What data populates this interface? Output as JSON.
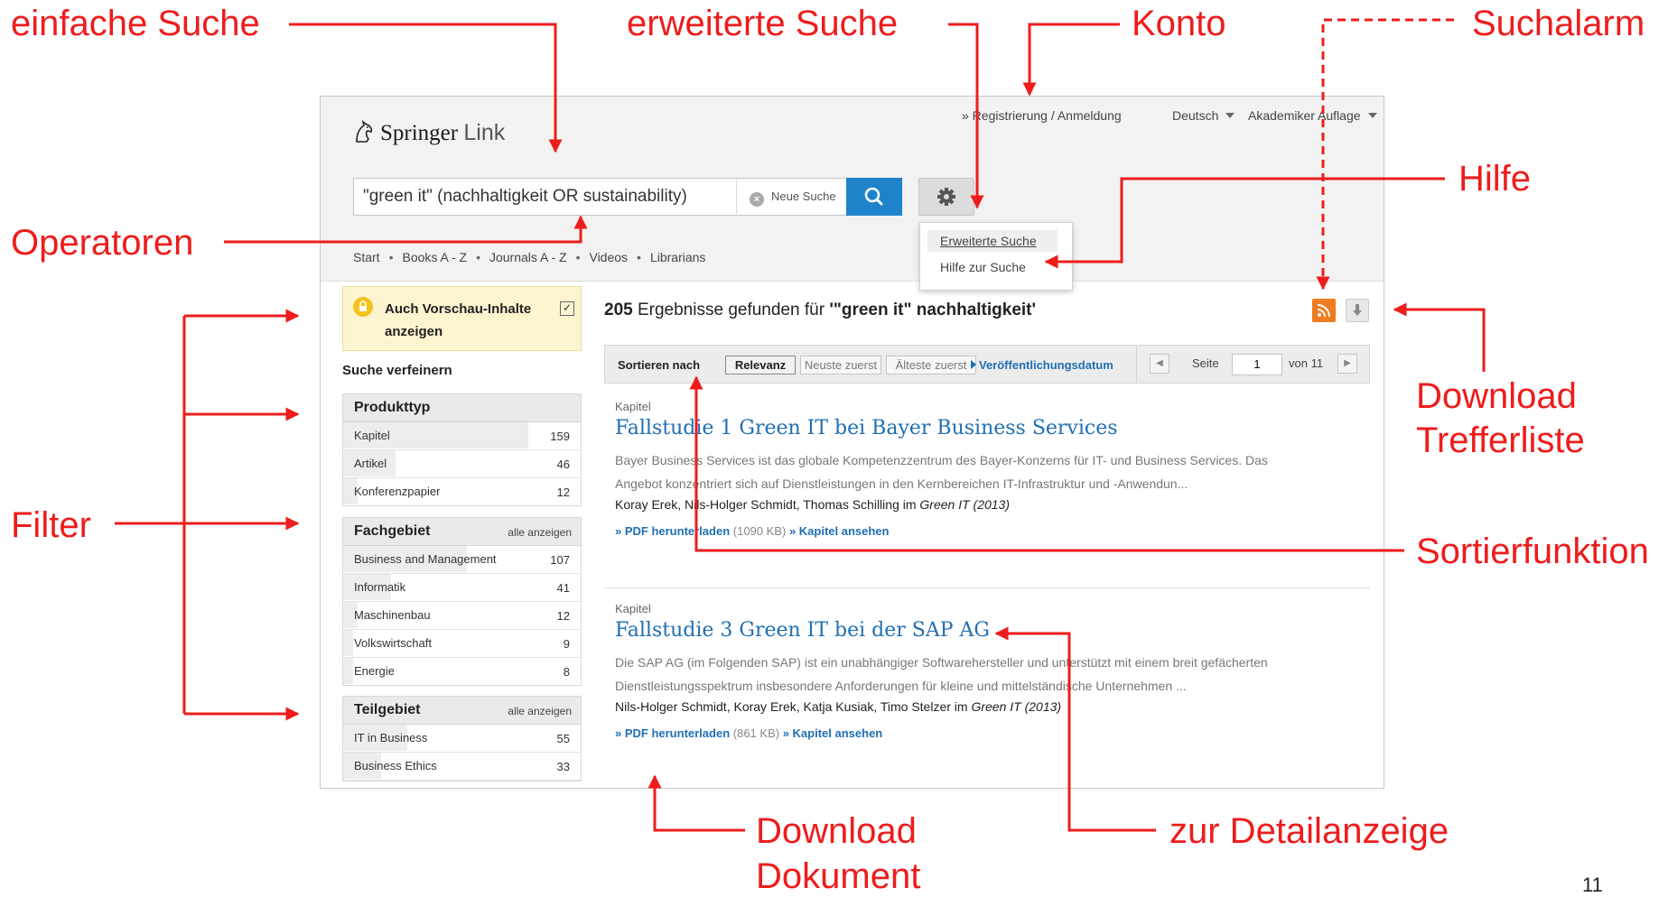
{
  "annotations": {
    "einfache_suche": "einfache Suche",
    "erweiterte_suche": "erweiterte Suche",
    "konto": "Konto",
    "suchalarm": "Suchalarm",
    "hilfe": "Hilfe",
    "operatoren": "Operatoren",
    "filter": "Filter",
    "download_trefferliste_1": "Download",
    "download_trefferliste_2": "Trefferliste",
    "sortierfunktion": "Sortierfunktion",
    "download_dokument_1": "Download",
    "download_dokument_2": "Dokument",
    "zur_detailanzeige": "zur Detailanzeige",
    "color": "#ee1c1c"
  },
  "slide_number": "11",
  "app": {
    "logo_springer": "Springer",
    "logo_link": "Link",
    "top_links": {
      "register": "» Registrierung / Anmeldung",
      "language": "Deutsch",
      "edition": "Akademiker Auflage"
    },
    "search": {
      "value": "\"green it\" (nachhaltigkeit OR sustainability)",
      "new_search": "Neue Suche",
      "button_icon": "search-icon",
      "settings_icon": "gear-icon"
    },
    "dropdown": {
      "advanced": "Erweiterte Suche",
      "help": "Hilfe zur Suche"
    },
    "nav": [
      "Start",
      "Books A - Z",
      "Journals A - Z",
      "Videos",
      "Librarians"
    ]
  },
  "sidebar": {
    "preview_label": "Auch Vorschau-Inhalte anzeigen",
    "preview_checked": true,
    "refine_label": "Suche verfeinern",
    "facets": [
      {
        "title": "Produkttyp",
        "show_all": "",
        "items": [
          {
            "label": "Kapitel",
            "count": "159",
            "share": 0.78
          },
          {
            "label": "Artikel",
            "count": "46",
            "share": 0.22
          },
          {
            "label": "Konferenzpapier",
            "count": "12",
            "share": 0.06
          }
        ]
      },
      {
        "title": "Fachgebiet",
        "show_all": "alle anzeigen",
        "items": [
          {
            "label": "Business and Management",
            "count": "107",
            "share": 0.52
          },
          {
            "label": "Informatik",
            "count": "41",
            "share": 0.2
          },
          {
            "label": "Maschinenbau",
            "count": "12",
            "share": 0.06
          },
          {
            "label": "Volkswirtschaft",
            "count": "9",
            "share": 0.04
          },
          {
            "label": "Energie",
            "count": "8",
            "share": 0.04
          }
        ]
      },
      {
        "title": "Teilgebiet",
        "show_all": "alle anzeigen",
        "items": [
          {
            "label": "IT in Business",
            "count": "55",
            "share": 0.27
          },
          {
            "label": "Business Ethics",
            "count": "33",
            "share": 0.16
          }
        ]
      }
    ]
  },
  "results_header": {
    "count": "205",
    "text": "Ergebnisse gefunden für",
    "query": "'\"green it\" nachhaltigkeit'"
  },
  "sortbar": {
    "label": "Sortieren nach",
    "relevance": "Relevanz",
    "newest": "Neuste zuerst",
    "oldest": "Älteste zuerst",
    "pubdate": "Veröffentlichungsdatum",
    "page_label": "Seite",
    "page_value": "1",
    "page_total": "von 11"
  },
  "results": [
    {
      "type": "Kapitel",
      "title": "Fallstudie 1 Green IT bei Bayer Business Services",
      "snippet": "Bayer Business Services ist das globale Kompetenzzentrum des Bayer-Konzerns für IT- und Business Services. Das Angebot konzentriert sich auf Dienstleistungen in den Kernbereichen IT-Infrastruktur und -Anwendun...",
      "authors": "Koray Erek, Nils-Holger Schmidt, Thomas Schilling im",
      "source": "Green IT (2013)",
      "pdf_link": "» PDF herunterladen",
      "size": "(1090 KB)",
      "view_link": "» Kapitel ansehen"
    },
    {
      "type": "Kapitel",
      "title": "Fallstudie 3 Green IT bei der SAP AG",
      "snippet": "Die SAP AG (im Folgenden SAP) ist ein unabhängiger Softwarehersteller und unterstützt mit einem breit gefächerten Dienstleistungsspektrum insbesondere Anforderungen für kleine und mittelständische Unternehmen ...",
      "authors": "Nils-Holger Schmidt, Koray Erek, Katja Kusiak, Timo Stelzer im",
      "source": "Green IT (2013)",
      "pdf_link": "» PDF herunterladen",
      "size": "(861 KB)",
      "view_link": "» Kapitel ansehen"
    }
  ]
}
